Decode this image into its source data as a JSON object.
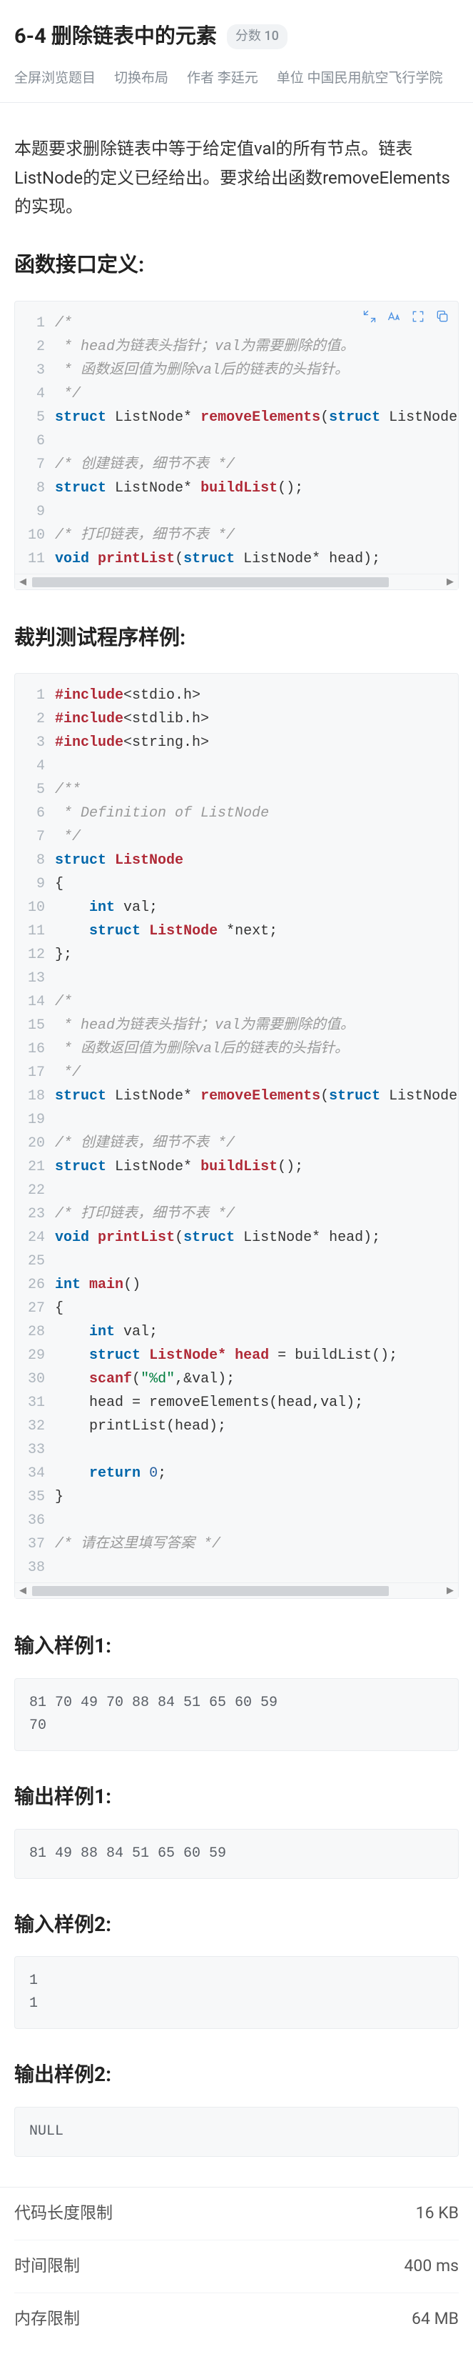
{
  "header": {
    "title": "6-4 删除链表中的元素",
    "score_label": "分数 10",
    "meta": {
      "fullscreen": "全屏浏览题目",
      "layout": "切换布局",
      "author_label": "作者",
      "author": "李廷元",
      "org_label": "单位",
      "org": "中国民用航空飞行学院"
    }
  },
  "desc": "本题要求删除链表中等于给定值val的所有节点。链表ListNode的定义已经给出。要求给出函数removeElements的实现。",
  "sec_interface": "函数接口定义:",
  "code1": [
    {
      "n": "1",
      "t": "cm",
      "s": "/*"
    },
    {
      "n": "2",
      "t": "cm",
      "s": " * head为链表头指针；val为需要删除的值。"
    },
    {
      "n": "3",
      "t": "cm",
      "s": " * 函数返回值为删除val后的链表的头指针。"
    },
    {
      "n": "4",
      "t": "cm",
      "s": " */"
    },
    {
      "n": "5",
      "t": "mix",
      "parts": [
        {
          "t": "kw",
          "s": "struct"
        },
        {
          "t": "",
          "s": " ListNode* "
        },
        {
          "t": "fn",
          "s": "removeElements"
        },
        {
          "t": "",
          "s": "("
        },
        {
          "t": "kw",
          "s": "struct"
        },
        {
          "t": "",
          "s": " ListNode* he"
        }
      ]
    },
    {
      "n": "6",
      "t": "",
      "s": ""
    },
    {
      "n": "7",
      "t": "cm",
      "s": "/* 创建链表，细节不表 */"
    },
    {
      "n": "8",
      "t": "mix",
      "parts": [
        {
          "t": "kw",
          "s": "struct"
        },
        {
          "t": "",
          "s": " ListNode* "
        },
        {
          "t": "fn",
          "s": "buildList"
        },
        {
          "t": "",
          "s": "();"
        }
      ]
    },
    {
      "n": "9",
      "t": "",
      "s": ""
    },
    {
      "n": "10",
      "t": "cm",
      "s": "/* 打印链表，细节不表 */"
    },
    {
      "n": "11",
      "t": "mix",
      "parts": [
        {
          "t": "kw",
          "s": "void"
        },
        {
          "t": "",
          "s": " "
        },
        {
          "t": "fn",
          "s": "printList"
        },
        {
          "t": "",
          "s": "("
        },
        {
          "t": "kw",
          "s": "struct"
        },
        {
          "t": "",
          "s": " ListNode* head);"
        }
      ]
    }
  ],
  "sec_judge": "裁判测试程序样例:",
  "code2": [
    {
      "n": "1",
      "t": "mix",
      "parts": [
        {
          "t": "hl",
          "s": "#include"
        },
        {
          "t": "",
          "s": "<stdio.h>"
        }
      ]
    },
    {
      "n": "2",
      "t": "mix",
      "parts": [
        {
          "t": "hl",
          "s": "#include"
        },
        {
          "t": "",
          "s": "<stdlib.h>"
        }
      ]
    },
    {
      "n": "3",
      "t": "mix",
      "parts": [
        {
          "t": "hl",
          "s": "#include"
        },
        {
          "t": "",
          "s": "<string.h>"
        }
      ]
    },
    {
      "n": "4",
      "t": "",
      "s": ""
    },
    {
      "n": "5",
      "t": "cm",
      "s": "/**"
    },
    {
      "n": "6",
      "t": "cm",
      "s": " * Definition of ListNode"
    },
    {
      "n": "7",
      "t": "cm",
      "s": " */"
    },
    {
      "n": "8",
      "t": "mix",
      "parts": [
        {
          "t": "kw",
          "s": "struct"
        },
        {
          "t": "",
          "s": " "
        },
        {
          "t": "ty",
          "s": "ListNode"
        }
      ]
    },
    {
      "n": "9",
      "t": "",
      "s": "{"
    },
    {
      "n": "10",
      "t": "mix",
      "parts": [
        {
          "t": "",
          "s": "    "
        },
        {
          "t": "kw",
          "s": "int"
        },
        {
          "t": "",
          "s": " val;"
        }
      ]
    },
    {
      "n": "11",
      "t": "mix",
      "parts": [
        {
          "t": "",
          "s": "    "
        },
        {
          "t": "kw",
          "s": "struct"
        },
        {
          "t": "",
          "s": " "
        },
        {
          "t": "ty",
          "s": "ListNode"
        },
        {
          "t": "",
          "s": " *next;"
        }
      ]
    },
    {
      "n": "12",
      "t": "",
      "s": "};"
    },
    {
      "n": "13",
      "t": "",
      "s": ""
    },
    {
      "n": "14",
      "t": "cm",
      "s": "/*"
    },
    {
      "n": "15",
      "t": "cm",
      "s": " * head为链表头指针；val为需要删除的值。"
    },
    {
      "n": "16",
      "t": "cm",
      "s": " * 函数返回值为删除val后的链表的头指针。"
    },
    {
      "n": "17",
      "t": "cm",
      "s": " */"
    },
    {
      "n": "18",
      "t": "mix",
      "parts": [
        {
          "t": "kw",
          "s": "struct"
        },
        {
          "t": "",
          "s": " ListNode* "
        },
        {
          "t": "fn",
          "s": "removeElements"
        },
        {
          "t": "",
          "s": "("
        },
        {
          "t": "kw",
          "s": "struct"
        },
        {
          "t": "",
          "s": " ListNode* he"
        }
      ]
    },
    {
      "n": "19",
      "t": "",
      "s": ""
    },
    {
      "n": "20",
      "t": "cm",
      "s": "/* 创建链表，细节不表 */"
    },
    {
      "n": "21",
      "t": "mix",
      "parts": [
        {
          "t": "kw",
          "s": "struct"
        },
        {
          "t": "",
          "s": " ListNode* "
        },
        {
          "t": "fn",
          "s": "buildList"
        },
        {
          "t": "",
          "s": "();"
        }
      ]
    },
    {
      "n": "22",
      "t": "",
      "s": ""
    },
    {
      "n": "23",
      "t": "cm",
      "s": "/* 打印链表，细节不表 */"
    },
    {
      "n": "24",
      "t": "mix",
      "parts": [
        {
          "t": "kw",
          "s": "void"
        },
        {
          "t": "",
          "s": " "
        },
        {
          "t": "fn",
          "s": "printList"
        },
        {
          "t": "",
          "s": "("
        },
        {
          "t": "kw",
          "s": "struct"
        },
        {
          "t": "",
          "s": " ListNode* head);"
        }
      ]
    },
    {
      "n": "25",
      "t": "",
      "s": ""
    },
    {
      "n": "26",
      "t": "mix",
      "parts": [
        {
          "t": "kw",
          "s": "int"
        },
        {
          "t": "",
          "s": " "
        },
        {
          "t": "fn",
          "s": "main"
        },
        {
          "t": "",
          "s": "()"
        }
      ]
    },
    {
      "n": "27",
      "t": "",
      "s": "{"
    },
    {
      "n": "28",
      "t": "mix",
      "parts": [
        {
          "t": "",
          "s": "    "
        },
        {
          "t": "kw",
          "s": "int"
        },
        {
          "t": "",
          "s": " val;"
        }
      ]
    },
    {
      "n": "29",
      "t": "mix",
      "parts": [
        {
          "t": "",
          "s": "    "
        },
        {
          "t": "kw",
          "s": "struct"
        },
        {
          "t": "",
          "s": " "
        },
        {
          "t": "ty",
          "s": "ListNode*"
        },
        {
          "t": "",
          "s": " "
        },
        {
          "t": "ty",
          "s": "head"
        },
        {
          "t": "",
          "s": " = buildList();"
        }
      ]
    },
    {
      "n": "30",
      "t": "mix",
      "parts": [
        {
          "t": "",
          "s": "    "
        },
        {
          "t": "fn",
          "s": "scanf"
        },
        {
          "t": "",
          "s": "("
        },
        {
          "t": "str",
          "s": "\"%d\""
        },
        {
          "t": "",
          "s": ",&val);"
        }
      ]
    },
    {
      "n": "31",
      "t": "",
      "s": "    head = removeElements(head,val);"
    },
    {
      "n": "32",
      "t": "",
      "s": "    printList(head);"
    },
    {
      "n": "33",
      "t": "",
      "s": ""
    },
    {
      "n": "34",
      "t": "mix",
      "parts": [
        {
          "t": "",
          "s": "    "
        },
        {
          "t": "kw",
          "s": "return"
        },
        {
          "t": "",
          "s": " "
        },
        {
          "t": "num",
          "s": "0"
        },
        {
          "t": "",
          "s": ";"
        }
      ]
    },
    {
      "n": "35",
      "t": "",
      "s": "}"
    },
    {
      "n": "36",
      "t": "",
      "s": ""
    },
    {
      "n": "37",
      "t": "cm",
      "s": "/* 请在这里填写答案 */"
    },
    {
      "n": "38",
      "t": "",
      "s": ""
    }
  ],
  "samples": {
    "in1_label": "输入样例1:",
    "in1": "81 70 49 70 88 84 51 65 60 59\n70",
    "out1_label": "输出样例1:",
    "out1": "81 49 88 84 51 65 60 59",
    "in2_label": "输入样例2:",
    "in2": "1\n1",
    "out2_label": "输出样例2:",
    "out2": "NULL"
  },
  "limits": {
    "code_len_label": "代码长度限制",
    "code_len": "16 KB",
    "time_label": "时间限制",
    "time": "400 ms",
    "mem_label": "内存限制",
    "mem": "64 MB"
  }
}
